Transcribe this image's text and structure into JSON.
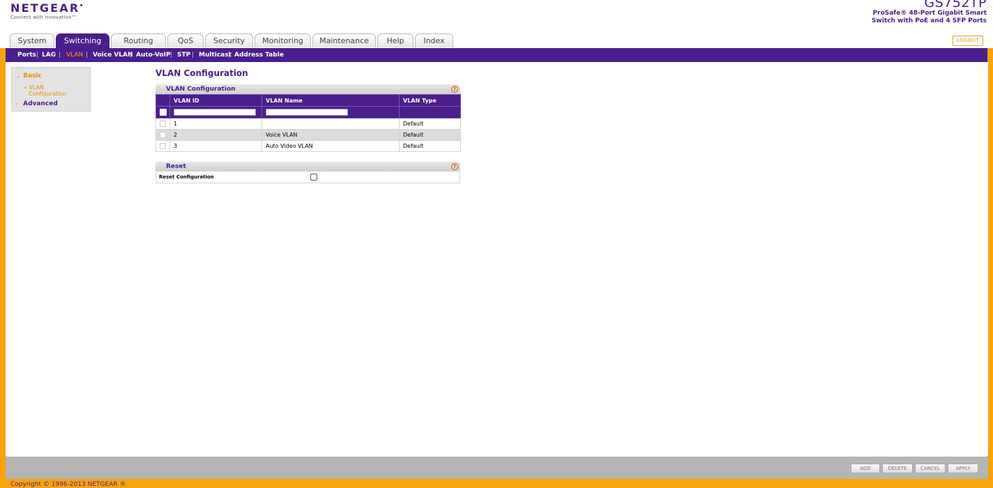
{
  "brand": {
    "logo": "NETGEAR",
    "tagline": "Connect with Innovation™",
    "model": "GS752TP",
    "description": "ProSafe® 48-Port Gigabit Smart Switch with PoE and 4 SFP Ports",
    "logout_label": "LOGOUT"
  },
  "tabs": [
    {
      "label": "System",
      "active": false
    },
    {
      "label": "Switching",
      "active": true
    },
    {
      "label": "Routing",
      "active": false
    },
    {
      "label": "QoS",
      "active": false
    },
    {
      "label": "Security",
      "active": false
    },
    {
      "label": "Monitoring",
      "active": false
    },
    {
      "label": "Maintenance",
      "active": false
    },
    {
      "label": "Help",
      "active": false
    },
    {
      "label": "Index",
      "active": false
    }
  ],
  "subnav": [
    {
      "label": "Ports",
      "active": false
    },
    {
      "label": "LAG",
      "active": false
    },
    {
      "label": "VLAN",
      "active": true
    },
    {
      "label": "Voice VLAN",
      "active": false
    },
    {
      "label": "Auto-VoIP",
      "active": false
    },
    {
      "label": "STP",
      "active": false
    },
    {
      "label": "Multicast",
      "active": false
    },
    {
      "label": "Address Table",
      "active": false
    }
  ],
  "leftnav": {
    "basic": "Basic",
    "vlan_config_line1": "VLAN",
    "vlan_config_line2": "Configuration",
    "advanced": "Advanced"
  },
  "page_title": "VLAN Configuration",
  "vlan_box": {
    "title": "VLAN Configuration",
    "help": "?",
    "columns": [
      "VLAN ID",
      "VLAN Name",
      "VLAN Type"
    ],
    "new_vlan_id": "",
    "new_vlan_name": "",
    "rows": [
      {
        "id": "1",
        "name": "",
        "type": "Default"
      },
      {
        "id": "2",
        "name": "Voice VLAN",
        "type": "Default"
      },
      {
        "id": "3",
        "name": "Auto Video VLAN",
        "type": "Default"
      }
    ]
  },
  "reset_box": {
    "title": "Reset",
    "help": "?",
    "label": "Reset Configuration",
    "checked": false
  },
  "buttons": {
    "add": "ADD",
    "delete": "DELETE",
    "cancel": "CANCEL",
    "apply": "APPLY"
  },
  "copyright": "Copyright © 1996-2013 NETGEAR ®",
  "colors": {
    "brand_purple": "#4b1e8d",
    "accent_orange": "#f8a40d"
  }
}
